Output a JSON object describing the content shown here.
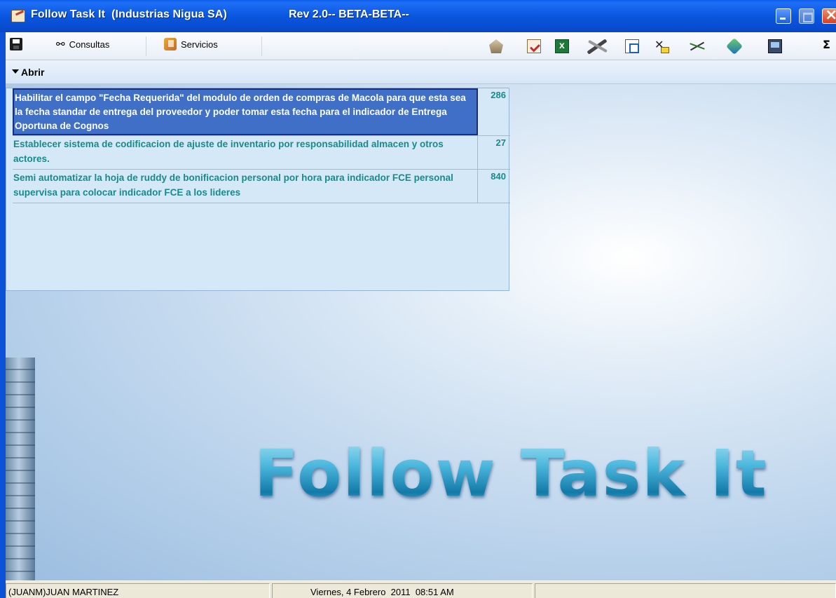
{
  "window": {
    "title": "Follow Task It  (Industrias Nigua SA)",
    "revision": "Rev 2.0-- BETA-BETA--"
  },
  "toolbar": {
    "consultas_label": "Consultas",
    "servicios_label": "Servicios",
    "sigma_label": "Σ"
  },
  "section": {
    "abrir_label": "Abrir"
  },
  "tasks": [
    {
      "description": "Habilitar el campo \"Fecha Requerida\" del modulo de orden de compras de Macola para que esta sea la fecha standar de entrega del proveedor y poder tomar esta fecha para el indicador de Entrega Oportuna de Cognos",
      "number": "286",
      "selected": true
    },
    {
      "description": "Establecer sistema de codificacion de ajuste de inventario por responsabilidad almacen y otros actores.",
      "number": "27",
      "selected": false
    },
    {
      "description": "Semi automatizar la hoja de ruddy de bonificacion personal por hora para indicador FCE personal supervisa para colocar indicador FCE a los lideres",
      "number": "840",
      "selected": false
    }
  ],
  "background": {
    "logo_text": "Follow Task It"
  },
  "statusbar": {
    "user": "(JUANM)JUAN MARTINEZ",
    "datetime": "Viernes, 4 Febrero  2011  08:51 AM"
  },
  "colors": {
    "titlebar": "#0a56e0",
    "selected_row": "#3f6fc6",
    "task_text": "#188a8a",
    "panel_bg": "#d4e8f8"
  }
}
